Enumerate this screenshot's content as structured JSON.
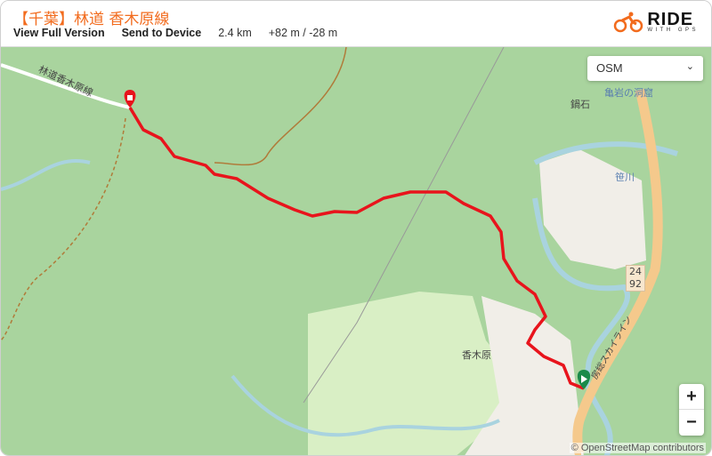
{
  "header": {
    "title": "【千葉】林道 香木原線",
    "view_full": "View Full Version",
    "send_device": "Send to Device",
    "distance": "2.4 km",
    "elevation": "+82 m / -28 m"
  },
  "logo": {
    "name": "RIDE",
    "sub": "WITH GPS",
    "color": "#f26b1d"
  },
  "map": {
    "layer_select": "OSM",
    "zoom_in": "+",
    "zoom_out": "−",
    "attribution": "© OpenStreetMap contributors",
    "labels": {
      "road_name": "林道香木原線",
      "place1": "鍋石",
      "place2": "亀岩の洞窟",
      "river": "笹川",
      "village": "香木原",
      "route_shield": "24\n92",
      "skyline": "房総スカイライン"
    },
    "route_color": "#e8141c",
    "start_marker_color": "#1a8a4a",
    "end_marker_color": "#e8141c"
  }
}
